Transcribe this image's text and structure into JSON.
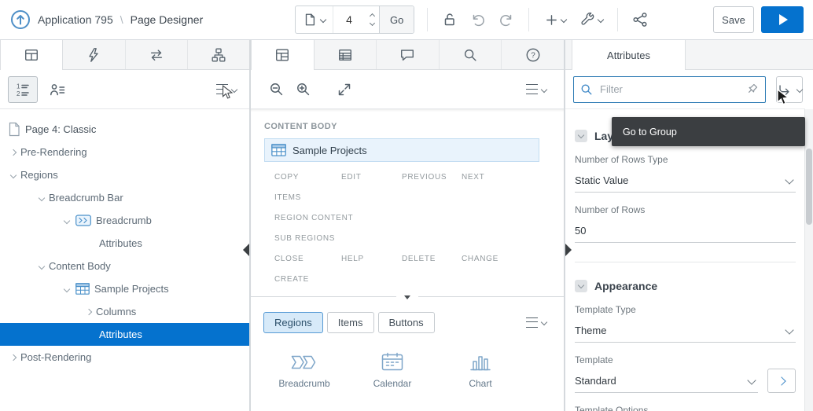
{
  "colors": {
    "accent": "#0572ce",
    "tree_selection_bg": "#0572ce",
    "region_highlight_bg": "#e9f3fc",
    "tooltip_bg": "#3b3e41",
    "filter_border": "#2f7cb5"
  },
  "header": {
    "app_label": "Application 795",
    "separator": "\\",
    "page_title": "Page Designer",
    "page_number": "4",
    "go_button": "Go",
    "save_button": "Save",
    "icons": [
      "apex-logo",
      "page-finder-document",
      "page-lock",
      "undo",
      "redo",
      "create-plus",
      "utilities-wrench",
      "shared-components",
      "run-play"
    ]
  },
  "left_panel": {
    "tabs": [
      "rendering",
      "dynamic-actions",
      "processing",
      "page-shared-components"
    ],
    "tree": [
      {
        "label": "Page 4: Classic",
        "icon": "page"
      },
      {
        "label": "Pre-Rendering",
        "state": "collapsed"
      },
      {
        "label": "Regions",
        "state": "expanded"
      },
      {
        "label": "Breadcrumb Bar",
        "state": "expanded"
      },
      {
        "label": "Breadcrumb",
        "state": "expanded",
        "icon": "breadcrumb-region"
      },
      {
        "label": "Attributes"
      },
      {
        "label": "Content Body",
        "state": "expanded"
      },
      {
        "label": "Sample Projects",
        "state": "expanded",
        "icon": "classic-report-region"
      },
      {
        "label": "Columns",
        "state": "collapsed"
      },
      {
        "label": "Attributes",
        "selected": true
      },
      {
        "label": "Post-Rendering",
        "state": "collapsed"
      }
    ]
  },
  "layout_panel": {
    "tabs": [
      "layout",
      "component-view",
      "messages",
      "page-search",
      "help"
    ],
    "section_label": "CONTENT BODY",
    "region_title": "Sample Projects",
    "drop_slots": [
      "COPY",
      "EDIT",
      "PREVIOUS",
      "NEXT",
      "ITEMS",
      "REGION CONTENT",
      "SUB REGIONS",
      "CLOSE",
      "HELP",
      "DELETE",
      "CHANGE",
      "CREATE"
    ],
    "gallery": {
      "tabs": [
        {
          "label": "Regions",
          "active": true
        },
        {
          "label": "Items",
          "active": false
        },
        {
          "label": "Buttons",
          "active": false
        }
      ],
      "items": [
        {
          "label": "Breadcrumb",
          "icon": "breadcrumb"
        },
        {
          "label": "Calendar",
          "icon": "calendar"
        },
        {
          "label": "Chart",
          "icon": "chart"
        }
      ]
    }
  },
  "attributes_panel": {
    "tab_label": "Attributes",
    "filter_placeholder": "Filter",
    "tooltip": "Go to Group",
    "sections": [
      {
        "title": "Layout",
        "fields": [
          {
            "label": "Number of Rows Type",
            "value": "Static Value",
            "control": "select"
          },
          {
            "label": "Number of Rows",
            "value": "50",
            "control": "text"
          }
        ]
      },
      {
        "title": "Appearance",
        "fields": [
          {
            "label": "Template Type",
            "value": "Theme",
            "control": "select"
          },
          {
            "label": "Template",
            "value": "Standard",
            "control": "select-with-go"
          },
          {
            "label": "Template Options",
            "value": "",
            "control": "clipped"
          }
        ]
      }
    ]
  }
}
